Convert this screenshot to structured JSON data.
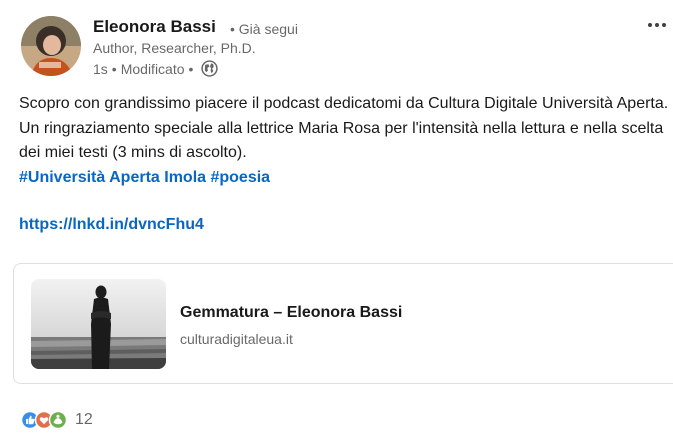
{
  "post": {
    "author": {
      "name": "Eleonora Bassi",
      "follow_state": "• Già segui",
      "headline": "Author, Researcher, Ph.D.",
      "time": "1s",
      "edited": "Modificato"
    },
    "icons": {
      "visibility": "globe-icon",
      "menu": "more-options-icon"
    },
    "body_text": "Scopro con grandissimo piacere il podcast dedicatomi da Cultura Digitale Università Aperta. Un ringraziamento speciale alla lettrice Maria Rosa per l'intensità nella lettura e nella scelta dei miei testi (3 mins di ascolto).",
    "hashtags": [
      "#Università Aperta Imola",
      "#poesia"
    ],
    "link": "https://lnkd.in/dvncFhu4",
    "preview": {
      "title": "Gemmatura – Eleonora Bassi",
      "domain": "culturadigitaleua.it"
    },
    "reactions": {
      "count": "12",
      "types": [
        "like-icon",
        "love-icon",
        "support-icon"
      ]
    }
  },
  "colors": {
    "link": "#0a66c2",
    "like": "#378fe9",
    "love": "#df704d",
    "support": "#6dae4f",
    "border": "#e0dfdc"
  }
}
